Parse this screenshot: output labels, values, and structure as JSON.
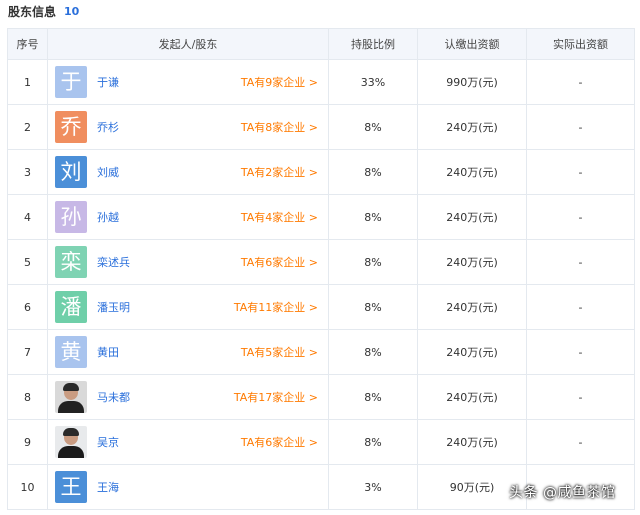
{
  "header": {
    "title": "股东信息",
    "count": "10"
  },
  "columns": [
    "序号",
    "发起人/股东",
    "持股比例",
    "认缴出资额",
    "实际出资额"
  ],
  "rows": [
    {
      "no": "1",
      "avatar_char": "于",
      "avatar_color": "#a9c4ee",
      "name": "于谦",
      "link": "TA有9家企业 >",
      "ratio": "33%",
      "subscribed": "990万(元)",
      "actual": "-"
    },
    {
      "no": "2",
      "avatar_char": "乔",
      "avatar_color": "#f08e5f",
      "name": "乔杉",
      "link": "TA有8家企业 >",
      "ratio": "8%",
      "subscribed": "240万(元)",
      "actual": "-"
    },
    {
      "no": "3",
      "avatar_char": "刘",
      "avatar_color": "#4b8fd8",
      "name": "刘威",
      "link": "TA有2家企业 >",
      "ratio": "8%",
      "subscribed": "240万(元)",
      "actual": "-"
    },
    {
      "no": "4",
      "avatar_char": "孙",
      "avatar_color": "#c7b8e6",
      "name": "孙越",
      "link": "TA有4家企业 >",
      "ratio": "8%",
      "subscribed": "240万(元)",
      "actual": "-"
    },
    {
      "no": "5",
      "avatar_char": "栾",
      "avatar_color": "#7fd3b3",
      "name": "栾述兵",
      "link": "TA有6家企业 >",
      "ratio": "8%",
      "subscribed": "240万(元)",
      "actual": "-"
    },
    {
      "no": "6",
      "avatar_char": "潘",
      "avatar_color": "#6fcfa9",
      "name": "潘玉明",
      "link": "TA有11家企业 >",
      "ratio": "8%",
      "subscribed": "240万(元)",
      "actual": "-"
    },
    {
      "no": "7",
      "avatar_char": "黄",
      "avatar_color": "#a9c4ee",
      "name": "黄田",
      "link": "TA有5家企业 >",
      "ratio": "8%",
      "subscribed": "240万(元)",
      "actual": "-"
    },
    {
      "no": "8",
      "avatar_char": "",
      "avatar_color": "",
      "name": "马未都",
      "link": "TA有17家企业 >",
      "ratio": "8%",
      "subscribed": "240万(元)",
      "actual": "-"
    },
    {
      "no": "9",
      "avatar_char": "",
      "avatar_color": "",
      "name": "吴京",
      "link": "TA有6家企业 >",
      "ratio": "8%",
      "subscribed": "240万(元)",
      "actual": "-"
    },
    {
      "no": "10",
      "avatar_char": "王",
      "avatar_color": "#4b8fd8",
      "name": "王海",
      "link": "",
      "ratio": "3%",
      "subscribed": "90万(元)",
      "actual": "-"
    }
  ],
  "watermark": "头条 @咸鱼茶馆"
}
